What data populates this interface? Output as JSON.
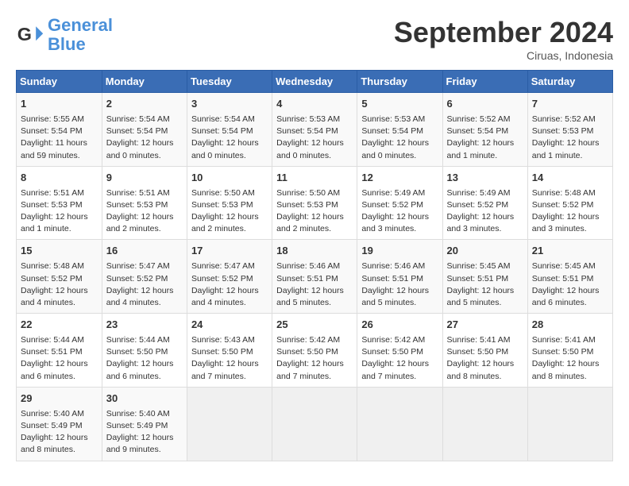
{
  "logo": {
    "line1": "General",
    "line2": "Blue"
  },
  "title": "September 2024",
  "subtitle": "Ciruas, Indonesia",
  "days_of_week": [
    "Sunday",
    "Monday",
    "Tuesday",
    "Wednesday",
    "Thursday",
    "Friday",
    "Saturday"
  ],
  "weeks": [
    [
      {
        "day": "1",
        "info": "Sunrise: 5:55 AM\nSunset: 5:54 PM\nDaylight: 11 hours and 59 minutes."
      },
      {
        "day": "2",
        "info": "Sunrise: 5:54 AM\nSunset: 5:54 PM\nDaylight: 12 hours and 0 minutes."
      },
      {
        "day": "3",
        "info": "Sunrise: 5:54 AM\nSunset: 5:54 PM\nDaylight: 12 hours and 0 minutes."
      },
      {
        "day": "4",
        "info": "Sunrise: 5:53 AM\nSunset: 5:54 PM\nDaylight: 12 hours and 0 minutes."
      },
      {
        "day": "5",
        "info": "Sunrise: 5:53 AM\nSunset: 5:54 PM\nDaylight: 12 hours and 0 minutes."
      },
      {
        "day": "6",
        "info": "Sunrise: 5:52 AM\nSunset: 5:54 PM\nDaylight: 12 hours and 1 minute."
      },
      {
        "day": "7",
        "info": "Sunrise: 5:52 AM\nSunset: 5:53 PM\nDaylight: 12 hours and 1 minute."
      }
    ],
    [
      {
        "day": "8",
        "info": "Sunrise: 5:51 AM\nSunset: 5:53 PM\nDaylight: 12 hours and 1 minute."
      },
      {
        "day": "9",
        "info": "Sunrise: 5:51 AM\nSunset: 5:53 PM\nDaylight: 12 hours and 2 minutes."
      },
      {
        "day": "10",
        "info": "Sunrise: 5:50 AM\nSunset: 5:53 PM\nDaylight: 12 hours and 2 minutes."
      },
      {
        "day": "11",
        "info": "Sunrise: 5:50 AM\nSunset: 5:53 PM\nDaylight: 12 hours and 2 minutes."
      },
      {
        "day": "12",
        "info": "Sunrise: 5:49 AM\nSunset: 5:52 PM\nDaylight: 12 hours and 3 minutes."
      },
      {
        "day": "13",
        "info": "Sunrise: 5:49 AM\nSunset: 5:52 PM\nDaylight: 12 hours and 3 minutes."
      },
      {
        "day": "14",
        "info": "Sunrise: 5:48 AM\nSunset: 5:52 PM\nDaylight: 12 hours and 3 minutes."
      }
    ],
    [
      {
        "day": "15",
        "info": "Sunrise: 5:48 AM\nSunset: 5:52 PM\nDaylight: 12 hours and 4 minutes."
      },
      {
        "day": "16",
        "info": "Sunrise: 5:47 AM\nSunset: 5:52 PM\nDaylight: 12 hours and 4 minutes."
      },
      {
        "day": "17",
        "info": "Sunrise: 5:47 AM\nSunset: 5:52 PM\nDaylight: 12 hours and 4 minutes."
      },
      {
        "day": "18",
        "info": "Sunrise: 5:46 AM\nSunset: 5:51 PM\nDaylight: 12 hours and 5 minutes."
      },
      {
        "day": "19",
        "info": "Sunrise: 5:46 AM\nSunset: 5:51 PM\nDaylight: 12 hours and 5 minutes."
      },
      {
        "day": "20",
        "info": "Sunrise: 5:45 AM\nSunset: 5:51 PM\nDaylight: 12 hours and 5 minutes."
      },
      {
        "day": "21",
        "info": "Sunrise: 5:45 AM\nSunset: 5:51 PM\nDaylight: 12 hours and 6 minutes."
      }
    ],
    [
      {
        "day": "22",
        "info": "Sunrise: 5:44 AM\nSunset: 5:51 PM\nDaylight: 12 hours and 6 minutes."
      },
      {
        "day": "23",
        "info": "Sunrise: 5:44 AM\nSunset: 5:50 PM\nDaylight: 12 hours and 6 minutes."
      },
      {
        "day": "24",
        "info": "Sunrise: 5:43 AM\nSunset: 5:50 PM\nDaylight: 12 hours and 7 minutes."
      },
      {
        "day": "25",
        "info": "Sunrise: 5:42 AM\nSunset: 5:50 PM\nDaylight: 12 hours and 7 minutes."
      },
      {
        "day": "26",
        "info": "Sunrise: 5:42 AM\nSunset: 5:50 PM\nDaylight: 12 hours and 7 minutes."
      },
      {
        "day": "27",
        "info": "Sunrise: 5:41 AM\nSunset: 5:50 PM\nDaylight: 12 hours and 8 minutes."
      },
      {
        "day": "28",
        "info": "Sunrise: 5:41 AM\nSunset: 5:50 PM\nDaylight: 12 hours and 8 minutes."
      }
    ],
    [
      {
        "day": "29",
        "info": "Sunrise: 5:40 AM\nSunset: 5:49 PM\nDaylight: 12 hours and 8 minutes."
      },
      {
        "day": "30",
        "info": "Sunrise: 5:40 AM\nSunset: 5:49 PM\nDaylight: 12 hours and 9 minutes."
      },
      {
        "day": "",
        "info": ""
      },
      {
        "day": "",
        "info": ""
      },
      {
        "day": "",
        "info": ""
      },
      {
        "day": "",
        "info": ""
      },
      {
        "day": "",
        "info": ""
      }
    ]
  ]
}
